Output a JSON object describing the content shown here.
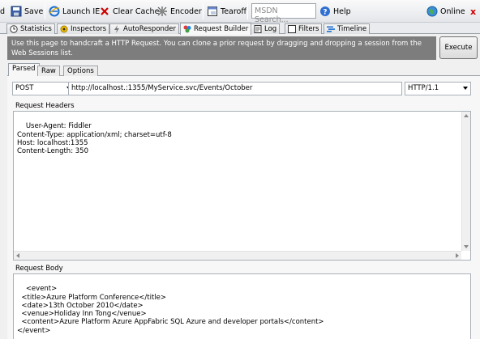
{
  "toolbar": {
    "cut_label": "d",
    "save_label": "Save",
    "launch_ie_label": "Launch IE",
    "clear_cache_label": "Clear Cache",
    "encoder_label": "Encoder",
    "tearoff_label": "Tearoff",
    "search_placeholder": "MSDN Search...",
    "help_label": "Help",
    "online_label": "Online",
    "close_glyph": "x"
  },
  "tabs": [
    {
      "label": "Statistics",
      "icon": "clock-icon"
    },
    {
      "label": "Inspectors",
      "icon": "inspectors-icon"
    },
    {
      "label": "AutoResponder",
      "icon": "lightning-icon"
    },
    {
      "label": "Request Builder",
      "icon": "builder-icon",
      "active": true
    },
    {
      "label": "Log",
      "icon": "log-icon"
    },
    {
      "label": "Filters",
      "icon": "checkbox-icon"
    },
    {
      "label": "Timeline",
      "icon": "timeline-icon"
    }
  ],
  "banner": {
    "text": "Use this page to handcraft a HTTP Request. You can clone a prior request by dragging and dropping a session from the Web Sessions list.",
    "execute_label": "Execute"
  },
  "subtabs": [
    {
      "label": "Parsed",
      "active": true
    },
    {
      "label": "Raw"
    },
    {
      "label": "Options"
    }
  ],
  "request": {
    "method": "POST",
    "url": "http://localhost.:1355/MyService.svc/Events/October",
    "version": "HTTP/1.1"
  },
  "headers": {
    "label": "Request Headers",
    "text": "User-Agent: Fiddler\nContent-Type: application/xml; charset=utf-8\nHost: localhost:1355\nContent-Length: 350"
  },
  "body": {
    "label": "Request Body",
    "text": "<event>\n  <title>Azure Platform Conference</title>\n  <date>13th October 2010</date>\n  <venue>Holiday Inn Tong</venue>\n  <content>Azure Platform Azure AppFabric SQL Azure and developer portals</content>\n</event>"
  },
  "colors": {
    "banner_bg": "#7d7d7d",
    "close_red": "#cc0000"
  }
}
